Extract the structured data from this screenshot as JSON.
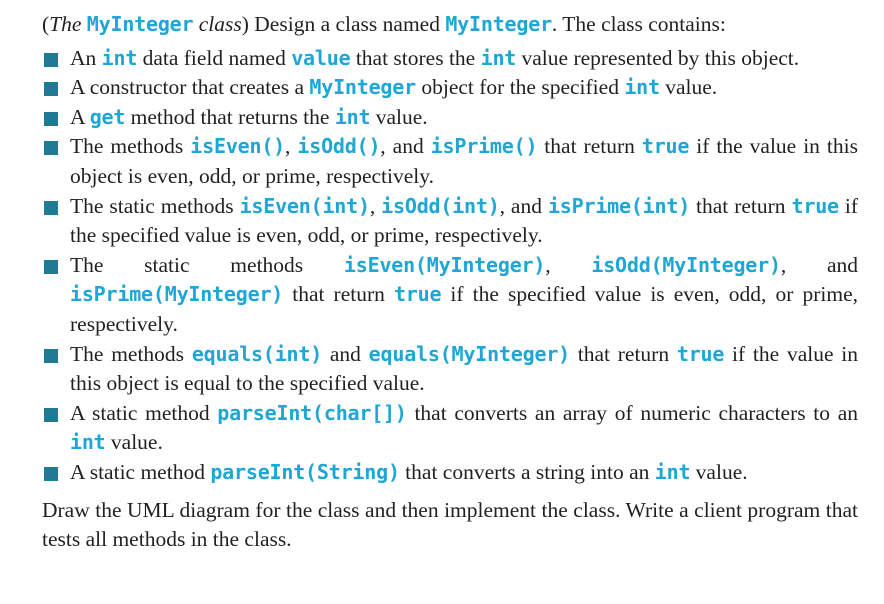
{
  "intro": {
    "open_paren": "(",
    "the_word": "The",
    "class_name_1": "MyInteger",
    "class_word": "class",
    "close_text": ") Design a class named ",
    "class_name_2": "MyInteger",
    "tail": ". The class contains:"
  },
  "items": [
    {
      "t1": "An ",
      "c1": "int",
      "t2": " data field named ",
      "c2": "value",
      "t3": " that stores the ",
      "c3": "int",
      "t4": " value represented by this object."
    },
    {
      "t1": "A constructor that creates a ",
      "c1": "MyInteger",
      "t2": " object for the specified ",
      "c2": "int",
      "t3": " value."
    },
    {
      "t1": "A ",
      "c1": "get",
      "t2": " method that returns the ",
      "c2": "int",
      "t3": " value."
    },
    {
      "t1": "The methods ",
      "c1": "isEven()",
      "t2": ", ",
      "c2": "isOdd()",
      "t3": ", and ",
      "c3": "isPrime()",
      "t4": " that return ",
      "c4": "true",
      "t5": " if the value in this object is even, odd, or prime, respectively."
    },
    {
      "t1": "The static methods ",
      "c1": "isEven(int)",
      "t2": ", ",
      "c2": "isOdd(int)",
      "t3": ", and ",
      "c3": "isPrime(int)",
      "t4": " that return ",
      "c4": "true",
      "t5": " if the specified value is even, odd, or prime, respectively."
    },
    {
      "t1": "The static methods ",
      "c1": "isEven(MyInteger)",
      "t2": ", ",
      "c2": "isOdd(MyInteger)",
      "t3": ", and ",
      "c3": "isPrime(MyInteger)",
      "t4": " that return ",
      "c4": "true",
      "t5": " if the specified value is even, odd, or prime, respectively."
    },
    {
      "t1": "The methods ",
      "c1": "equals(int)",
      "t2": " and ",
      "c2": "equals(MyInteger)",
      "t3": " that return ",
      "c3": "true",
      "t4": " if the value in this object is equal to the specified value."
    },
    {
      "t1": "A static method ",
      "c1": "parseInt(char[])",
      "t2": " that converts an array of numeric characters to an ",
      "c2": "int",
      "t3": " value."
    },
    {
      "t1": "A static method ",
      "c1": "parseInt(String)",
      "t2": " that converts a string into an ",
      "c2": "int",
      "t3": " value."
    }
  ],
  "outro": "Draw the UML diagram for the class and then implement the class. Write a client program that tests all methods in the class.",
  "colors": {
    "code": "#1ea6d6",
    "bullet": "#1f7a94",
    "text": "#231f20"
  },
  "icons": {
    "bullet": "square-bullet-icon"
  }
}
